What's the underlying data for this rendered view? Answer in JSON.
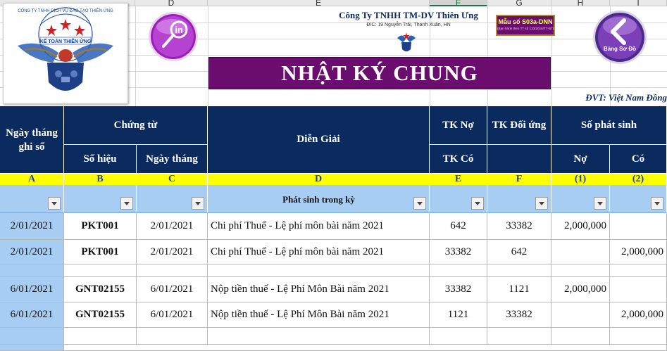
{
  "column_letters": [
    "D",
    "E",
    "F",
    "G",
    "H",
    "I"
  ],
  "logo": {
    "arc_text": "CÔNG TY TNHH DỊCH VỤ ĐÀO TẠO THIÊN ỨNG",
    "ribbon_text": "KẾ TOÁN THIÊN ỨNG"
  },
  "company": {
    "name": "Công Ty TNHH TM-DV Thiên Ưng",
    "address": "Đ/C: 19 Nguyễn Trãi, Thanh Xuân, HN"
  },
  "form": {
    "code": "Mẫu số S03a-DNN",
    "note": "(Ban hành theo TT số 133/2016/TT-BTC)"
  },
  "back_button": {
    "label": "Bảng Sơ Đồ"
  },
  "title": "NHẬT KÝ CHUNG",
  "currency_unit": "ĐVT: Việt Nam Đồng",
  "headers": {
    "date": "Ngày tháng ghi sổ",
    "voucher": "Chứng từ",
    "voucher_no": "Số hiệu",
    "voucher_date": "Ngày tháng",
    "description": "Diễn Giải",
    "debit_acc": "TK Nợ",
    "credit_acc": "TK Có",
    "contra_acc": "TK Đối ứng",
    "amount": "Số phát sinh",
    "debit": "Nợ",
    "credit": "Có"
  },
  "col_letters": [
    "A",
    "B",
    "C",
    "D",
    "E",
    "F",
    "(1)",
    "(2)"
  ],
  "filter_row_label": "Phát sinh trong kỳ",
  "rows": [
    {
      "date": "2/01/2021",
      "voucher_no": "PKT001",
      "voucher_date": "2/01/2021",
      "description": "Chi phí Thuế - Lệ phí môn bài năm 2021",
      "account": "642",
      "contra": "33382",
      "debit": "2,000,000",
      "credit": ""
    },
    {
      "date": "2/01/2021",
      "voucher_no": "PKT001",
      "voucher_date": "2/01/2021",
      "description": "Chi phí Thuế - Lệ phí môn bài năm 2021",
      "account": "33382",
      "contra": "642",
      "debit": "",
      "credit": "2,000,000"
    },
    {
      "date": "6/01/2021",
      "voucher_no": "GNT02155",
      "voucher_date": "6/01/2021",
      "description": "Nộp tiền thuế - Lệ Phí Môn Bài năm 2021",
      "account": "33382",
      "contra": "1121",
      "debit": "2,000,000",
      "credit": ""
    },
    {
      "date": "6/01/2021",
      "voucher_no": "GNT02155",
      "voucher_date": "6/01/2021",
      "description": "Nộp tiền thuế - Lệ Phí Môn Bài năm 2021",
      "account": "1121",
      "contra": "33382",
      "debit": "",
      "credit": "2,000,000"
    }
  ],
  "colors": {
    "navy": "#0b2a5e",
    "title_bar": "#6a0d6f",
    "yellow": "#ffff00",
    "filter_blue": "#a8cdf2",
    "excel_green": "#217346"
  }
}
